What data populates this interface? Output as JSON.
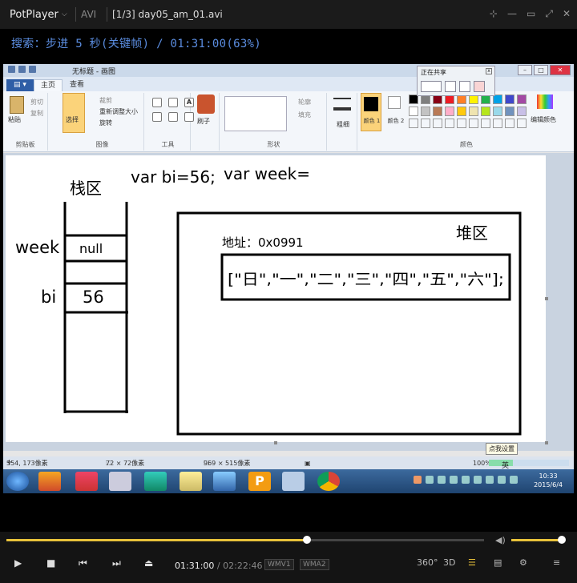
{
  "player": {
    "app_name": "PotPlayer",
    "format": "AVI",
    "file_title": "[1/3] day05_am_01.avi",
    "osd": "搜索：步进 5 秒(关键帧) / 01:31:00(63%)",
    "current_time": "01:31:00",
    "separator": "/",
    "total_time": "02:22:46",
    "video_codec": "WMV1",
    "audio_codec": "WMA2",
    "seek_progress": 0.63,
    "volume": 0.96,
    "accent_color": "#e8c23a",
    "osd_color": "#5b8de0",
    "labels": {
      "r360": "360°",
      "r3d": "3D"
    }
  },
  "paint": {
    "window_title": "无标题 - 画图",
    "tabs": [
      "主页",
      "查看"
    ],
    "groups": {
      "clipboard": {
        "label": "剪贴板",
        "paste": "粘贴",
        "cut": "剪切",
        "copy": "复制"
      },
      "image": {
        "label": "图像",
        "select": "选择",
        "crop": "裁剪",
        "resize": "重新调整大小",
        "rotate": "旋转"
      },
      "tools": {
        "label": "工具"
      },
      "brush": {
        "label": "刷子"
      },
      "shapes": {
        "label": "形状",
        "outline": "轮廓",
        "fill": "填充"
      },
      "size": {
        "label": "粗细"
      },
      "colors": {
        "label": "颜色",
        "color1": "颜色 1",
        "color2": "颜色 2",
        "edit": "编辑颜色"
      }
    },
    "share": {
      "title": "正在共享"
    },
    "palette": [
      "#000000",
      "#7f7f7f",
      "#880015",
      "#ed1c24",
      "#ff7f27",
      "#fff200",
      "#22b14c",
      "#00a2e8",
      "#3f48cc",
      "#a349a4",
      "#ffffff",
      "#c3c3c3",
      "#b97a57",
      "#ffaec9",
      "#ffc90e",
      "#efe4b0",
      "#b5e61d",
      "#99d9ea",
      "#7092be",
      "#c8bfe7"
    ],
    "tooltip": "点我设置",
    "status": {
      "position": "354, 173像素",
      "selection": "72 × 72像素",
      "size": "969 × 515像素",
      "zoom": "100%"
    }
  },
  "drawing": {
    "stack_title": "栈区",
    "heap_title": "堆区",
    "code_line1": "var bi=56;",
    "code_line2": "var week=",
    "var_week": "week",
    "var_week_value": "null",
    "var_bi": "bi",
    "var_bi_value": "56",
    "address": "地址：0x0991",
    "array_literal": "[\"日\",\"一\",\"二\",\"三\",\"四\",\"五\",\"六\"];"
  },
  "taskbar": {
    "clock_time": "10:33",
    "clock_date": "2015/6/4",
    "ime": "英"
  }
}
